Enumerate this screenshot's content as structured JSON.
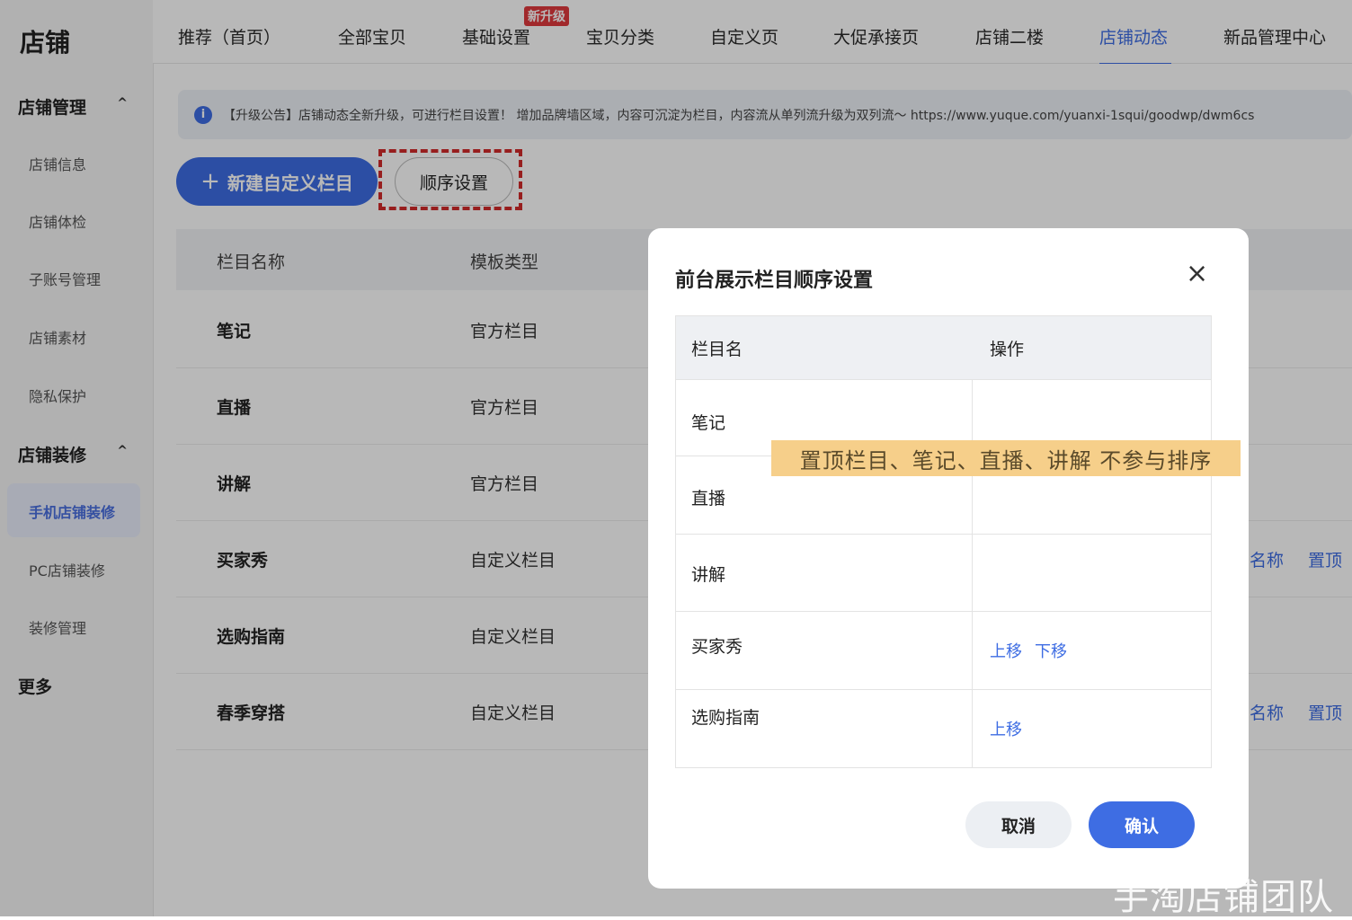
{
  "sidebar": {
    "title": "店铺",
    "groups": [
      {
        "label": "店铺管理",
        "items": [
          "店铺信息",
          "店铺体检",
          "子账号管理",
          "店铺素材",
          "隐私保护"
        ]
      },
      {
        "label": "店铺装修",
        "items": [
          "手机店铺装修",
          "PC店铺装修",
          "装修管理"
        ]
      }
    ],
    "more": "更多",
    "chevron": "^"
  },
  "topnav": {
    "tabs": [
      "推荐（首页）",
      "全部宝贝",
      "基础设置",
      "宝贝分类",
      "自定义页",
      "大促承接页",
      "店铺二楼",
      "店铺动态",
      "新品管理中心"
    ],
    "active_tab": "店铺动态",
    "badge": "新升级"
  },
  "notice": {
    "icon": "i",
    "text": "【升级公告】店铺动态全新升级，可进行栏目设置！ 增加品牌墙区域，内容可沉淀为栏目，内容流从单列流升级为双列流～ https://www.yuque.com/yuanxi-1squi/goodwp/dwm6cs"
  },
  "toolbar": {
    "new_column_plus": "+",
    "new_column": "新建自定义栏目",
    "order_settings": "顺序设置"
  },
  "table": {
    "headers": [
      "栏目名称",
      "模板类型"
    ],
    "rows": [
      {
        "name": "笔记",
        "type": "官方栏目",
        "actions": []
      },
      {
        "name": "直播",
        "type": "官方栏目",
        "actions": []
      },
      {
        "name": "讲解",
        "type": "官方栏目",
        "actions": []
      },
      {
        "name": "买家秀",
        "type": "自定义栏目",
        "actions": [
          "名称",
          "置顶"
        ]
      },
      {
        "name": "选购指南",
        "type": "自定义栏目",
        "actions": []
      },
      {
        "name": "春季穿搭",
        "type": "自定义栏目",
        "actions": [
          "名称",
          "置顶"
        ]
      }
    ]
  },
  "modal": {
    "title": "前台展示栏目顺序设置",
    "close": "×",
    "headers": [
      "栏目名",
      "操作"
    ],
    "rows": [
      {
        "name": "笔记",
        "ops": []
      },
      {
        "name": "直播",
        "ops": []
      },
      {
        "name": "讲解",
        "ops": []
      },
      {
        "name": "买家秀",
        "ops": [
          "上移",
          "下移"
        ]
      },
      {
        "name": "选购指南",
        "ops": [
          "上移"
        ]
      }
    ],
    "tooltip": "置顶栏目、笔记、直播、讲解 不参与排序",
    "cancel": "取消",
    "confirm": "确认"
  },
  "watermark": "手淘店铺团队",
  "colors": {
    "accent": "#3e6de3",
    "badge": "#e0393e",
    "highlight_border": "#d12a2a",
    "tooltip_bg": "#f6cf8a"
  }
}
